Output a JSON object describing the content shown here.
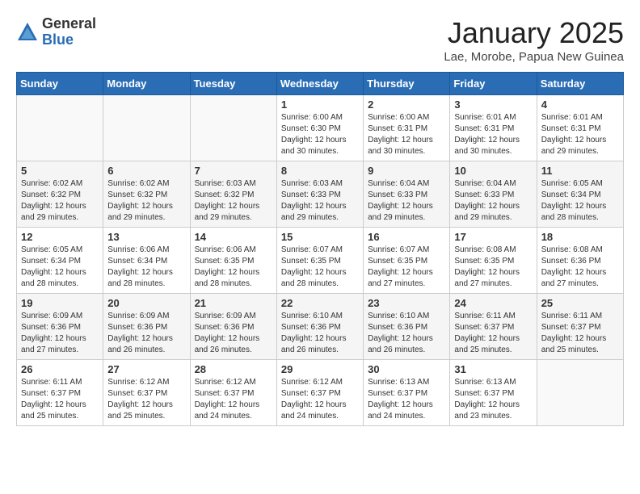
{
  "header": {
    "logo_general": "General",
    "logo_blue": "Blue",
    "month_title": "January 2025",
    "location": "Lae, Morobe, Papua New Guinea"
  },
  "weekdays": [
    "Sunday",
    "Monday",
    "Tuesday",
    "Wednesday",
    "Thursday",
    "Friday",
    "Saturday"
  ],
  "weeks": [
    [
      {
        "day": "",
        "info": ""
      },
      {
        "day": "",
        "info": ""
      },
      {
        "day": "",
        "info": ""
      },
      {
        "day": "1",
        "info": "Sunrise: 6:00 AM\nSunset: 6:30 PM\nDaylight: 12 hours\nand 30 minutes."
      },
      {
        "day": "2",
        "info": "Sunrise: 6:00 AM\nSunset: 6:31 PM\nDaylight: 12 hours\nand 30 minutes."
      },
      {
        "day": "3",
        "info": "Sunrise: 6:01 AM\nSunset: 6:31 PM\nDaylight: 12 hours\nand 30 minutes."
      },
      {
        "day": "4",
        "info": "Sunrise: 6:01 AM\nSunset: 6:31 PM\nDaylight: 12 hours\nand 29 minutes."
      }
    ],
    [
      {
        "day": "5",
        "info": "Sunrise: 6:02 AM\nSunset: 6:32 PM\nDaylight: 12 hours\nand 29 minutes."
      },
      {
        "day": "6",
        "info": "Sunrise: 6:02 AM\nSunset: 6:32 PM\nDaylight: 12 hours\nand 29 minutes."
      },
      {
        "day": "7",
        "info": "Sunrise: 6:03 AM\nSunset: 6:32 PM\nDaylight: 12 hours\nand 29 minutes."
      },
      {
        "day": "8",
        "info": "Sunrise: 6:03 AM\nSunset: 6:33 PM\nDaylight: 12 hours\nand 29 minutes."
      },
      {
        "day": "9",
        "info": "Sunrise: 6:04 AM\nSunset: 6:33 PM\nDaylight: 12 hours\nand 29 minutes."
      },
      {
        "day": "10",
        "info": "Sunrise: 6:04 AM\nSunset: 6:33 PM\nDaylight: 12 hours\nand 29 minutes."
      },
      {
        "day": "11",
        "info": "Sunrise: 6:05 AM\nSunset: 6:34 PM\nDaylight: 12 hours\nand 28 minutes."
      }
    ],
    [
      {
        "day": "12",
        "info": "Sunrise: 6:05 AM\nSunset: 6:34 PM\nDaylight: 12 hours\nand 28 minutes."
      },
      {
        "day": "13",
        "info": "Sunrise: 6:06 AM\nSunset: 6:34 PM\nDaylight: 12 hours\nand 28 minutes."
      },
      {
        "day": "14",
        "info": "Sunrise: 6:06 AM\nSunset: 6:35 PM\nDaylight: 12 hours\nand 28 minutes."
      },
      {
        "day": "15",
        "info": "Sunrise: 6:07 AM\nSunset: 6:35 PM\nDaylight: 12 hours\nand 28 minutes."
      },
      {
        "day": "16",
        "info": "Sunrise: 6:07 AM\nSunset: 6:35 PM\nDaylight: 12 hours\nand 27 minutes."
      },
      {
        "day": "17",
        "info": "Sunrise: 6:08 AM\nSunset: 6:35 PM\nDaylight: 12 hours\nand 27 minutes."
      },
      {
        "day": "18",
        "info": "Sunrise: 6:08 AM\nSunset: 6:36 PM\nDaylight: 12 hours\nand 27 minutes."
      }
    ],
    [
      {
        "day": "19",
        "info": "Sunrise: 6:09 AM\nSunset: 6:36 PM\nDaylight: 12 hours\nand 27 minutes."
      },
      {
        "day": "20",
        "info": "Sunrise: 6:09 AM\nSunset: 6:36 PM\nDaylight: 12 hours\nand 26 minutes."
      },
      {
        "day": "21",
        "info": "Sunrise: 6:09 AM\nSunset: 6:36 PM\nDaylight: 12 hours\nand 26 minutes."
      },
      {
        "day": "22",
        "info": "Sunrise: 6:10 AM\nSunset: 6:36 PM\nDaylight: 12 hours\nand 26 minutes."
      },
      {
        "day": "23",
        "info": "Sunrise: 6:10 AM\nSunset: 6:36 PM\nDaylight: 12 hours\nand 26 minutes."
      },
      {
        "day": "24",
        "info": "Sunrise: 6:11 AM\nSunset: 6:37 PM\nDaylight: 12 hours\nand 25 minutes."
      },
      {
        "day": "25",
        "info": "Sunrise: 6:11 AM\nSunset: 6:37 PM\nDaylight: 12 hours\nand 25 minutes."
      }
    ],
    [
      {
        "day": "26",
        "info": "Sunrise: 6:11 AM\nSunset: 6:37 PM\nDaylight: 12 hours\nand 25 minutes."
      },
      {
        "day": "27",
        "info": "Sunrise: 6:12 AM\nSunset: 6:37 PM\nDaylight: 12 hours\nand 25 minutes."
      },
      {
        "day": "28",
        "info": "Sunrise: 6:12 AM\nSunset: 6:37 PM\nDaylight: 12 hours\nand 24 minutes."
      },
      {
        "day": "29",
        "info": "Sunrise: 6:12 AM\nSunset: 6:37 PM\nDaylight: 12 hours\nand 24 minutes."
      },
      {
        "day": "30",
        "info": "Sunrise: 6:13 AM\nSunset: 6:37 PM\nDaylight: 12 hours\nand 24 minutes."
      },
      {
        "day": "31",
        "info": "Sunrise: 6:13 AM\nSunset: 6:37 PM\nDaylight: 12 hours\nand 23 minutes."
      },
      {
        "day": "",
        "info": ""
      }
    ]
  ]
}
